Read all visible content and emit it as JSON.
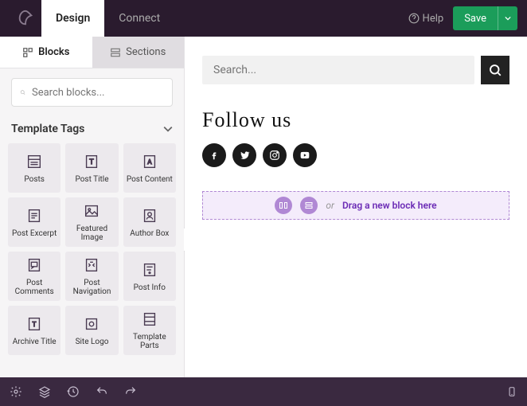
{
  "nav": {
    "design": "Design",
    "connect": "Connect",
    "help": "Help",
    "save": "Save"
  },
  "sidebar": {
    "tabs": {
      "blocks": "Blocks",
      "sections": "Sections"
    },
    "search_placeholder": "Search blocks...",
    "section_title": "Template Tags",
    "blocks": [
      {
        "label": "Posts"
      },
      {
        "label": "Post Title"
      },
      {
        "label": "Post Content"
      },
      {
        "label": "Post Excerpt"
      },
      {
        "label": "Featured Image"
      },
      {
        "label": "Author Box"
      },
      {
        "label": "Post Comments"
      },
      {
        "label": "Post Navigation"
      },
      {
        "label": "Post Info"
      },
      {
        "label": "Archive Title"
      },
      {
        "label": "Site Logo"
      },
      {
        "label": "Template Parts"
      }
    ]
  },
  "canvas": {
    "search_placeholder": "Search...",
    "follow_heading": "Follow us",
    "dropzone": {
      "or": "or",
      "link": "Drag a new block here"
    }
  }
}
